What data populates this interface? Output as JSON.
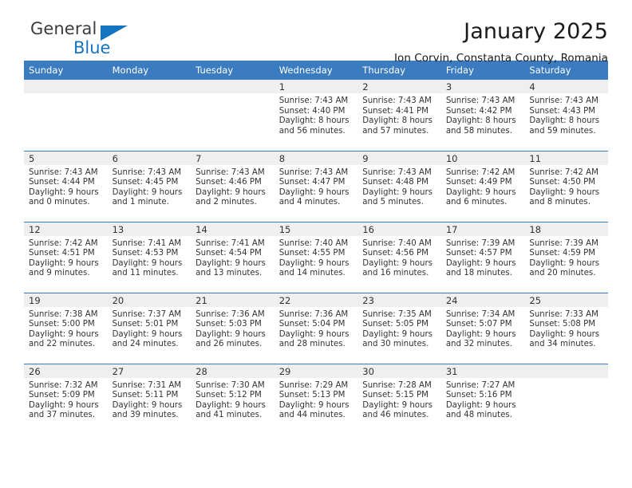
{
  "logo": {
    "word_one": "General",
    "word_two": "Blue",
    "triangle_icon": "triangle-icon",
    "accent_color": "#1574bf"
  },
  "header": {
    "title": "January 2025",
    "subtitle": "Ion Corvin, Constanta County, Romania"
  },
  "theme": {
    "header_blue": "#3b7cc0",
    "date_band_gray": "#efefef",
    "text_color": "#333333"
  },
  "calendar": {
    "weekday_headers": [
      "Sunday",
      "Monday",
      "Tuesday",
      "Wednesday",
      "Thursday",
      "Friday",
      "Saturday"
    ],
    "weeks": [
      [
        {
          "day": "",
          "empty": true
        },
        {
          "day": "",
          "empty": true
        },
        {
          "day": "",
          "empty": true
        },
        {
          "day": "1",
          "sunrise": "Sunrise: 7:43 AM",
          "sunset": "Sunset: 4:40 PM",
          "daylight_1": "Daylight: 8 hours",
          "daylight_2": "and 56 minutes."
        },
        {
          "day": "2",
          "sunrise": "Sunrise: 7:43 AM",
          "sunset": "Sunset: 4:41 PM",
          "daylight_1": "Daylight: 8 hours",
          "daylight_2": "and 57 minutes."
        },
        {
          "day": "3",
          "sunrise": "Sunrise: 7:43 AM",
          "sunset": "Sunset: 4:42 PM",
          "daylight_1": "Daylight: 8 hours",
          "daylight_2": "and 58 minutes."
        },
        {
          "day": "4",
          "sunrise": "Sunrise: 7:43 AM",
          "sunset": "Sunset: 4:43 PM",
          "daylight_1": "Daylight: 8 hours",
          "daylight_2": "and 59 minutes."
        }
      ],
      [
        {
          "day": "5",
          "sunrise": "Sunrise: 7:43 AM",
          "sunset": "Sunset: 4:44 PM",
          "daylight_1": "Daylight: 9 hours",
          "daylight_2": "and 0 minutes."
        },
        {
          "day": "6",
          "sunrise": "Sunrise: 7:43 AM",
          "sunset": "Sunset: 4:45 PM",
          "daylight_1": "Daylight: 9 hours",
          "daylight_2": "and 1 minute."
        },
        {
          "day": "7",
          "sunrise": "Sunrise: 7:43 AM",
          "sunset": "Sunset: 4:46 PM",
          "daylight_1": "Daylight: 9 hours",
          "daylight_2": "and 2 minutes."
        },
        {
          "day": "8",
          "sunrise": "Sunrise: 7:43 AM",
          "sunset": "Sunset: 4:47 PM",
          "daylight_1": "Daylight: 9 hours",
          "daylight_2": "and 4 minutes."
        },
        {
          "day": "9",
          "sunrise": "Sunrise: 7:43 AM",
          "sunset": "Sunset: 4:48 PM",
          "daylight_1": "Daylight: 9 hours",
          "daylight_2": "and 5 minutes."
        },
        {
          "day": "10",
          "sunrise": "Sunrise: 7:42 AM",
          "sunset": "Sunset: 4:49 PM",
          "daylight_1": "Daylight: 9 hours",
          "daylight_2": "and 6 minutes."
        },
        {
          "day": "11",
          "sunrise": "Sunrise: 7:42 AM",
          "sunset": "Sunset: 4:50 PM",
          "daylight_1": "Daylight: 9 hours",
          "daylight_2": "and 8 minutes."
        }
      ],
      [
        {
          "day": "12",
          "sunrise": "Sunrise: 7:42 AM",
          "sunset": "Sunset: 4:51 PM",
          "daylight_1": "Daylight: 9 hours",
          "daylight_2": "and 9 minutes."
        },
        {
          "day": "13",
          "sunrise": "Sunrise: 7:41 AM",
          "sunset": "Sunset: 4:53 PM",
          "daylight_1": "Daylight: 9 hours",
          "daylight_2": "and 11 minutes."
        },
        {
          "day": "14",
          "sunrise": "Sunrise: 7:41 AM",
          "sunset": "Sunset: 4:54 PM",
          "daylight_1": "Daylight: 9 hours",
          "daylight_2": "and 13 minutes."
        },
        {
          "day": "15",
          "sunrise": "Sunrise: 7:40 AM",
          "sunset": "Sunset: 4:55 PM",
          "daylight_1": "Daylight: 9 hours",
          "daylight_2": "and 14 minutes."
        },
        {
          "day": "16",
          "sunrise": "Sunrise: 7:40 AM",
          "sunset": "Sunset: 4:56 PM",
          "daylight_1": "Daylight: 9 hours",
          "daylight_2": "and 16 minutes."
        },
        {
          "day": "17",
          "sunrise": "Sunrise: 7:39 AM",
          "sunset": "Sunset: 4:57 PM",
          "daylight_1": "Daylight: 9 hours",
          "daylight_2": "and 18 minutes."
        },
        {
          "day": "18",
          "sunrise": "Sunrise: 7:39 AM",
          "sunset": "Sunset: 4:59 PM",
          "daylight_1": "Daylight: 9 hours",
          "daylight_2": "and 20 minutes."
        }
      ],
      [
        {
          "day": "19",
          "sunrise": "Sunrise: 7:38 AM",
          "sunset": "Sunset: 5:00 PM",
          "daylight_1": "Daylight: 9 hours",
          "daylight_2": "and 22 minutes."
        },
        {
          "day": "20",
          "sunrise": "Sunrise: 7:37 AM",
          "sunset": "Sunset: 5:01 PM",
          "daylight_1": "Daylight: 9 hours",
          "daylight_2": "and 24 minutes."
        },
        {
          "day": "21",
          "sunrise": "Sunrise: 7:36 AM",
          "sunset": "Sunset: 5:03 PM",
          "daylight_1": "Daylight: 9 hours",
          "daylight_2": "and 26 minutes."
        },
        {
          "day": "22",
          "sunrise": "Sunrise: 7:36 AM",
          "sunset": "Sunset: 5:04 PM",
          "daylight_1": "Daylight: 9 hours",
          "daylight_2": "and 28 minutes."
        },
        {
          "day": "23",
          "sunrise": "Sunrise: 7:35 AM",
          "sunset": "Sunset: 5:05 PM",
          "daylight_1": "Daylight: 9 hours",
          "daylight_2": "and 30 minutes."
        },
        {
          "day": "24",
          "sunrise": "Sunrise: 7:34 AM",
          "sunset": "Sunset: 5:07 PM",
          "daylight_1": "Daylight: 9 hours",
          "daylight_2": "and 32 minutes."
        },
        {
          "day": "25",
          "sunrise": "Sunrise: 7:33 AM",
          "sunset": "Sunset: 5:08 PM",
          "daylight_1": "Daylight: 9 hours",
          "daylight_2": "and 34 minutes."
        }
      ],
      [
        {
          "day": "26",
          "sunrise": "Sunrise: 7:32 AM",
          "sunset": "Sunset: 5:09 PM",
          "daylight_1": "Daylight: 9 hours",
          "daylight_2": "and 37 minutes."
        },
        {
          "day": "27",
          "sunrise": "Sunrise: 7:31 AM",
          "sunset": "Sunset: 5:11 PM",
          "daylight_1": "Daylight: 9 hours",
          "daylight_2": "and 39 minutes."
        },
        {
          "day": "28",
          "sunrise": "Sunrise: 7:30 AM",
          "sunset": "Sunset: 5:12 PM",
          "daylight_1": "Daylight: 9 hours",
          "daylight_2": "and 41 minutes."
        },
        {
          "day": "29",
          "sunrise": "Sunrise: 7:29 AM",
          "sunset": "Sunset: 5:13 PM",
          "daylight_1": "Daylight: 9 hours",
          "daylight_2": "and 44 minutes."
        },
        {
          "day": "30",
          "sunrise": "Sunrise: 7:28 AM",
          "sunset": "Sunset: 5:15 PM",
          "daylight_1": "Daylight: 9 hours",
          "daylight_2": "and 46 minutes."
        },
        {
          "day": "31",
          "sunrise": "Sunrise: 7:27 AM",
          "sunset": "Sunset: 5:16 PM",
          "daylight_1": "Daylight: 9 hours",
          "daylight_2": "and 48 minutes."
        },
        {
          "day": "",
          "empty": true
        }
      ]
    ]
  }
}
